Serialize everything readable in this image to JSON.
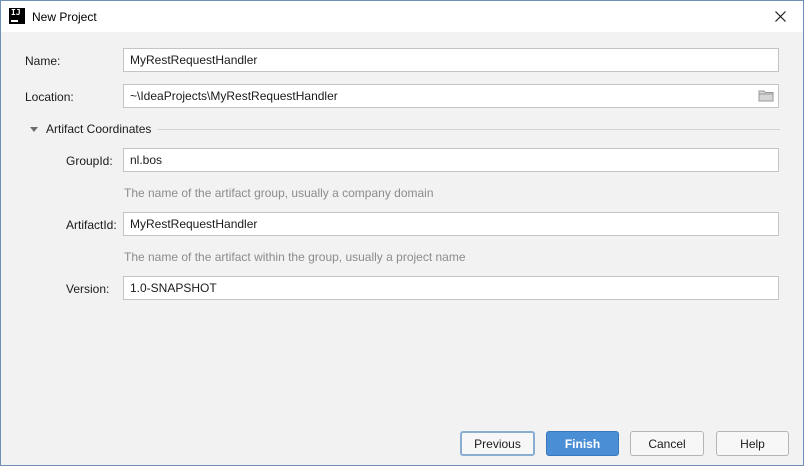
{
  "window": {
    "title": "New Project",
    "close_icon": "close-icon",
    "app_icon": "intellij-idea-icon",
    "app_icon_text": "IJ"
  },
  "form": {
    "name": {
      "label": "Name:",
      "value": "MyRestRequestHandler"
    },
    "location": {
      "label": "Location:",
      "value": "~\\IdeaProjects\\MyRestRequestHandler",
      "icon": "folder-icon"
    },
    "artifact_section": {
      "label": "Artifact Coordinates",
      "expanded": true
    },
    "group_id": {
      "label": "GroupId:",
      "value": "nl.bos",
      "hint": "The name of the artifact group, usually a company domain"
    },
    "artifact_id": {
      "label": "ArtifactId:",
      "value": "MyRestRequestHandler",
      "hint": "The name of the artifact within the group, usually a project name"
    },
    "version": {
      "label": "Version:",
      "value": "1.0-SNAPSHOT"
    }
  },
  "buttons": {
    "previous": "Previous",
    "finish": "Finish",
    "cancel": "Cancel",
    "help": "Help"
  },
  "colors": {
    "primary": "#4a8fd6",
    "hint_text": "#8c8c8c",
    "background": "#f2f2f2"
  }
}
